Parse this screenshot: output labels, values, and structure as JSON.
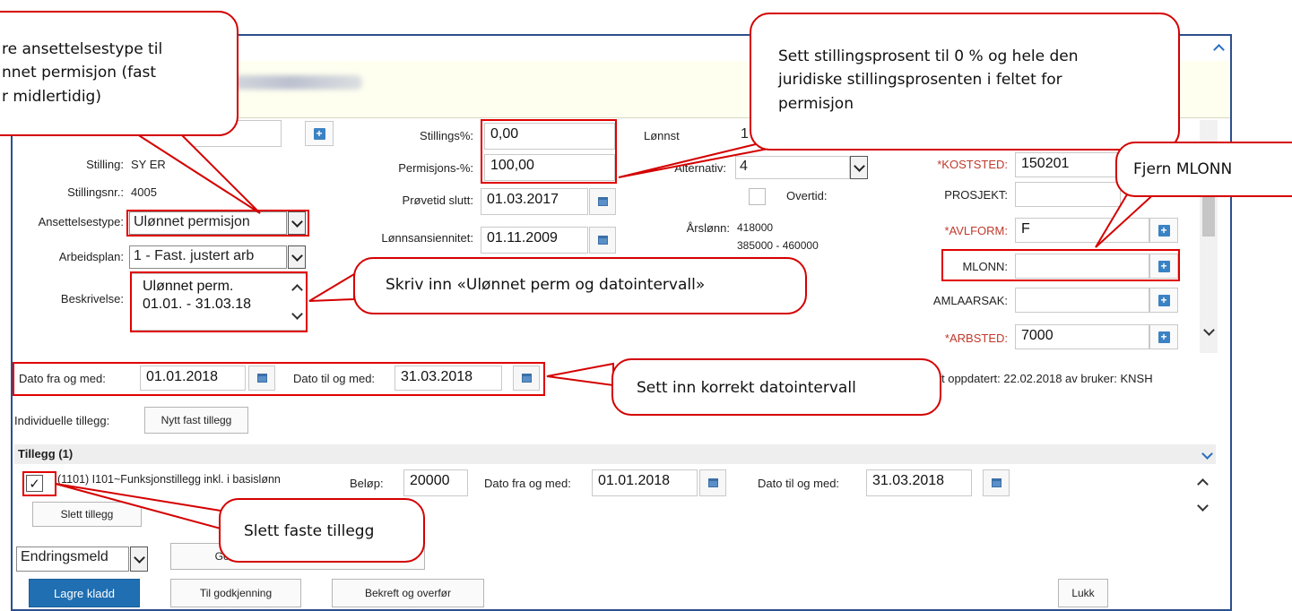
{
  "form": {
    "stilling_label": "Stilling:",
    "stilling_value": "SY       ER",
    "stillingsnr_label": "Stillingsnr.:",
    "stillingsnr_value": "4005",
    "ansettelsestype_label": "Ansettelsestype:",
    "ansettelsestype_value": "Ulønnet permisjon",
    "arbeidsplan_label": "Arbeidsplan:",
    "arbeidsplan_value": "1 - Fast. justert arb",
    "beskrivelse_label": "Beskrivelse:",
    "beskrivelse_line1": "Ulønnet perm.",
    "beskrivelse_line2": "01.01. - 31.03.18",
    "stillingspst_label": "Stillings%:",
    "stillingspst_value": "0,00",
    "permisjonspst_label": "Permisjons-%:",
    "permisjonspst_value": "100,00",
    "provetid_label": "Prøvetid slutt:",
    "provetid_value": "01.03.2017",
    "lonnsansiennitet_label": "Lønnsansiennitet:",
    "lonnsansiennitet_value": "01.11.2009",
    "lonns_label": "Lønnst",
    "lonns_value": "1",
    "alternativ_label": "Alternativ:",
    "alternativ_value": "4",
    "overtid_label": "Overtid:",
    "arslonn_label": "Årslønn:",
    "arslonn_value": "418000",
    "arslonn_range": "385000 - 460000",
    "koststed_label": "*KOSTSTED:",
    "koststed_value": "150201",
    "prosjekt_label": "PROSJEKT:",
    "avlform_label": "*AVLFORM:",
    "avlform_value": "F",
    "mlonn_label": "MLONN:",
    "amlaarsak_label": "AMLAARSAK:",
    "arbsted_label": "*ARBSTED:",
    "arbsted_value": "7000",
    "dato_fra_label": "Dato fra og med:",
    "dato_fra_value": "01.01.2018",
    "dato_til_label": "Dato til og med:",
    "dato_til_value": "31.03.2018",
    "sist_oppdatert": "t oppdatert: 22.02.2018 av bruker: KNSH",
    "individuelle_label": "Individuelle tillegg:",
    "nytt_fast_tillegg": "Nytt fast tillegg"
  },
  "tillegg": {
    "header": "Tillegg (1)",
    "item_label": "(1101) I101~Funksjonstillegg inkl. i basislønn",
    "belop_label": "Beløp:",
    "belop_value": "20000",
    "fra_label": "Dato fra og med:",
    "fra_value": "01.01.2018",
    "til_label": "Dato til og med:",
    "til_value": "31.03.2018",
    "slett_button": "Slett tillegg"
  },
  "footer": {
    "endringsmelding": "Endringsmeld",
    "generer_button": "Generer dokument (arkiveres ikke)",
    "lagre_kladd": "Lagre kladd",
    "til_godkjenning": "Til godkjenning",
    "bekreft_overfor": "Bekreft og overfør",
    "lukk": "Lukk"
  },
  "callouts": {
    "ansettelsestype_line1": "re ansettelsestype til",
    "ansettelsestype_line2": "nnet permisjon (fast",
    "ansettelsestype_line3": "r midlertidig)",
    "stillingsprosent_line1": "Sett stillingsprosent til 0 % og hele den",
    "stillingsprosent_line2": "juridiske stillingsprosenten i feltet for",
    "stillingsprosent_line3": "permisjon",
    "mlonn": "Fjern MLONN",
    "beskrivelse": "Skriv inn «Ulønnet perm og datointervall»",
    "datointervall": "Sett inn korrekt datointervall",
    "slett_faste": "Slett faste tillegg"
  },
  "colors": {
    "accent_blue": "#1f6fb2",
    "window_border": "#2d4f8c",
    "annotation_red": "#e00000",
    "header_band": "#fffff0"
  }
}
